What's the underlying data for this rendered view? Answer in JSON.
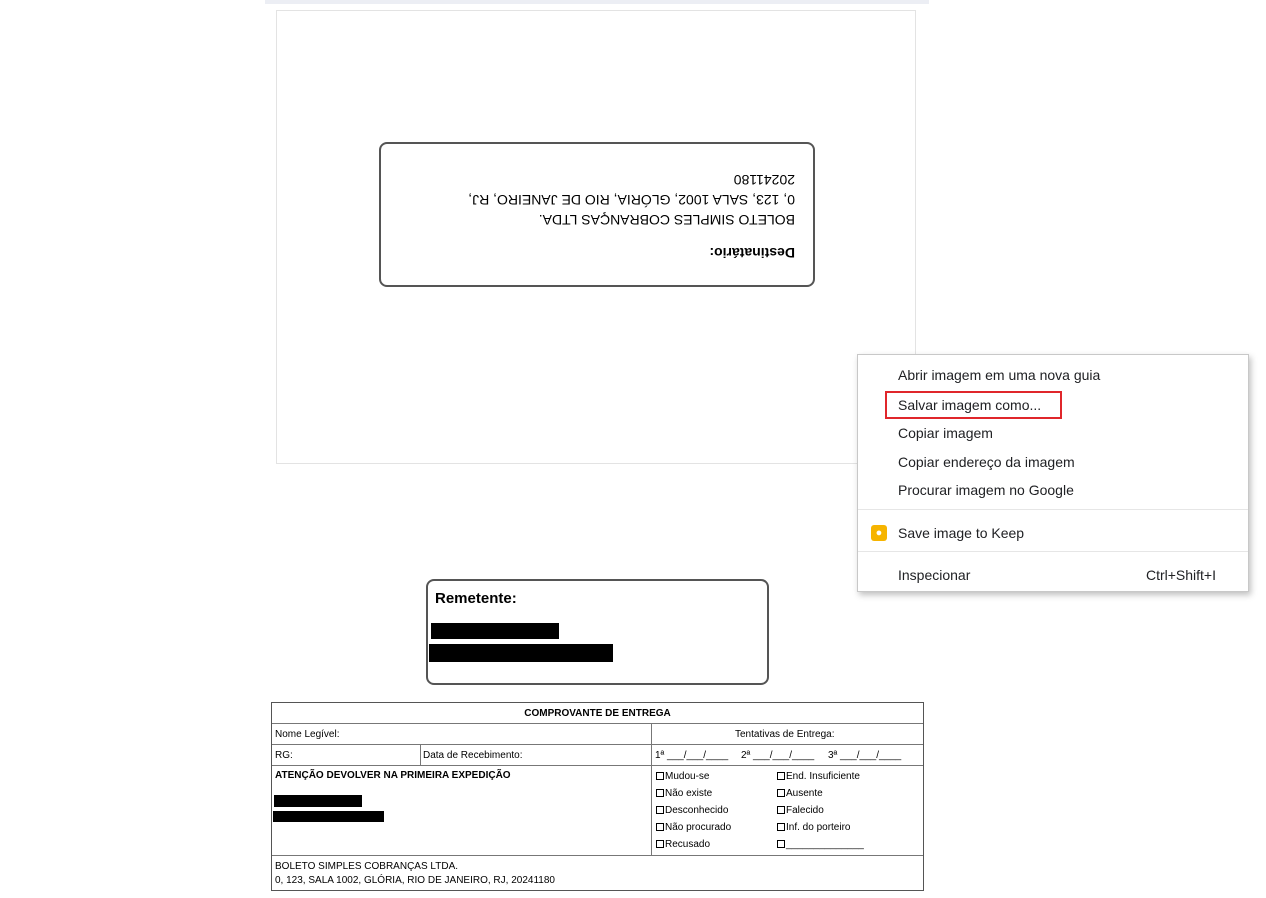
{
  "destinatario": {
    "title": "Destinatário:",
    "line1": "BOLETO SIMPLES COBRANÇAS LTDA.",
    "line2": "0, 123, SALA 1002, GLÓRIA, RIO DE JANEIRO, RJ,",
    "line3": "20241180"
  },
  "remetente": {
    "title": "Remetente:"
  },
  "receipt": {
    "header": "COMPROVANTE DE ENTREGA",
    "nome": "Nome Legível:",
    "tentativas": "Tentativas de Entrega:",
    "rg": "RG:",
    "data": "Data de Recebimento:",
    "attempt1": "1ª ___/___/____",
    "attempt2": "2ª ___/___/____",
    "attempt3": "3ª ___/___/____",
    "atencao": "ATENÇÃO DEVOLVER NA PRIMEIRA EXPEDIÇÃO",
    "options_left": [
      "Mudou-se",
      "Não existe",
      "Desconhecido",
      "Não procurado",
      "Recusado"
    ],
    "options_right": [
      "End. Insuficiente",
      "Ausente",
      "Falecido",
      "Inf. do porteiro",
      "______________"
    ],
    "footer_line1": "BOLETO SIMPLES COBRANÇAS LTDA.",
    "footer_line2": "0, 123, SALA 1002, GLÓRIA, RIO DE JANEIRO, RJ, 20241180"
  },
  "context_menu": {
    "open_new_tab": "Abrir imagem em uma nova guia",
    "save_as": "Salvar imagem como...",
    "copy_image": "Copiar imagem",
    "copy_address": "Copiar endereço da imagem",
    "search_google": "Procurar imagem no Google",
    "save_keep": "Save image to Keep",
    "inspect": "Inspecionar",
    "inspect_shortcut": "Ctrl+Shift+I",
    "keep_icon": "keep-bulb-icon",
    "highlight_color": "#e0262b"
  }
}
